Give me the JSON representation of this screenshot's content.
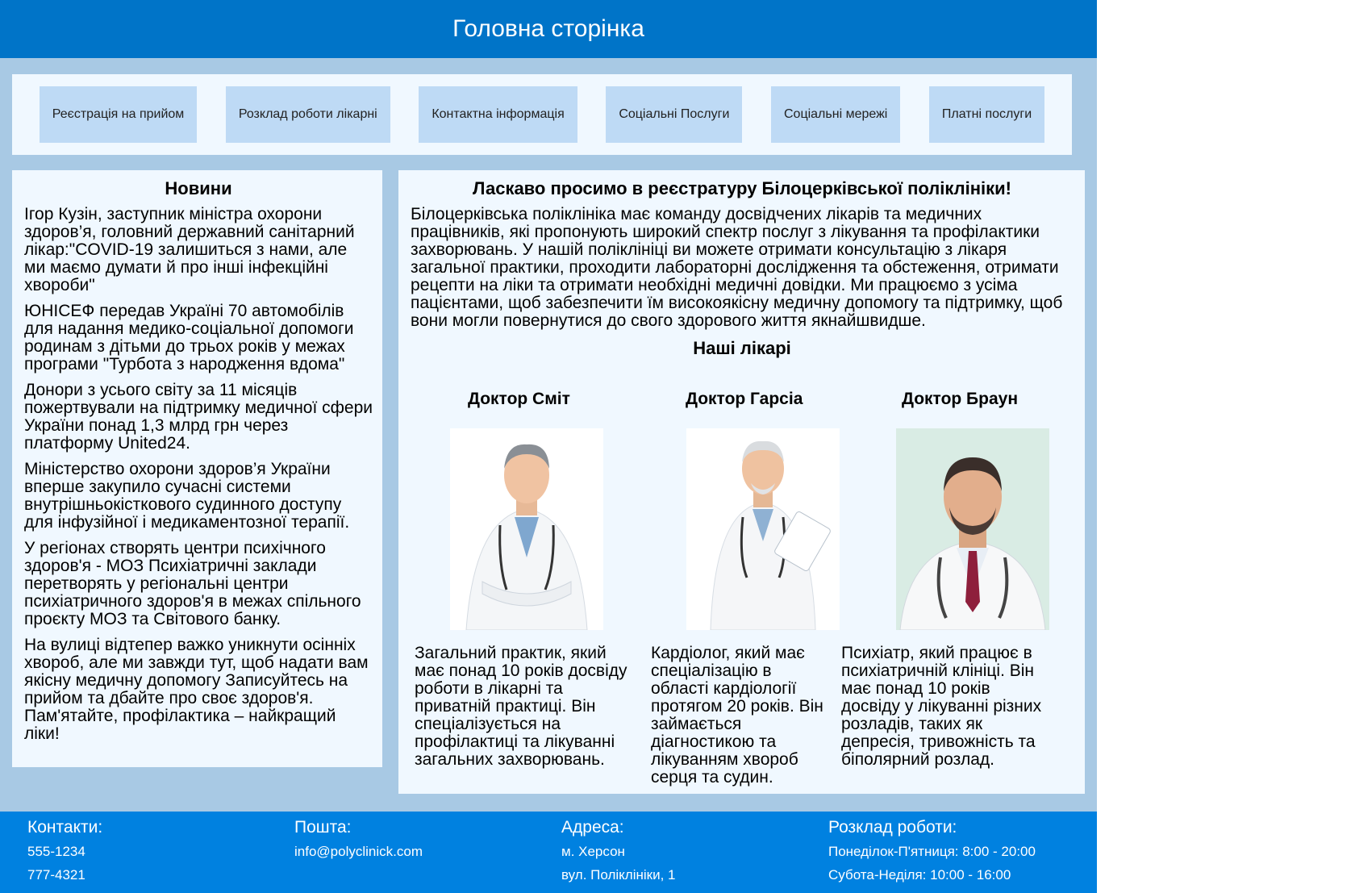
{
  "header": {
    "title": "Головна сторінка"
  },
  "nav": {
    "items": [
      "Реєстрація на прийом",
      "Розклад роботи лікарні",
      "Контактна інформація",
      "Соціальні Послуги",
      "Соціальні мережі",
      "Платні послуги"
    ]
  },
  "news": {
    "title": "Новини",
    "items": [
      "Ігор Кузін, заступник міністра охорони здоров’я, головний державний санітарний лікар:\"COVID-19 залишиться з нами, але ми маємо думати й про інші інфекційні хвороби\"",
      "ЮНІСЕФ передав Україні 70 автомобілів для надання медико-соціальної допомоги родинам з дітьми до трьох років у межах програми \"Турбота з народження вдома\"",
      "Донори з усього світу за 11 місяців пожертвували на підтримку медичної сфери України понад 1,3 млрд грн через платформу United24.",
      "Міністерство охорони здоров’я України вперше закупило сучасні системи внутрішньокісткового судинного доступу для інфузійної і медикаментозної терапії.",
      "У регіонах створять центри психічного здоров'я - МОЗ Психіатричні заклади перетворять у регіональні центри психіатричного здоров'я в межах спільного проєкту МОЗ та Світового банку.",
      "На вулиці відтепер важко уникнути осінніх хвороб, але ми завжди тут, щоб надати вам якісну медичну допомогу Записуйтесь на прийом та дбайте про своє здоров'я. Пам'ятайте, профілактика – найкращий ліки!"
    ]
  },
  "main": {
    "title": "Ласкаво просимо в реєстратуру Білоцерківської поліклініки!",
    "intro": "Білоцерківська поліклініка має команду досвідчених лікарів та медичних працівників, які пропонують широкий спектр послуг з лікування та профілактики захворювань. У нашій поліклініці ви можете отримати консультацію з лікаря загальної практики, проходити лабораторні дослідження та обстеження, отримати рецепти на ліки та отримати необхідні медичні довідки. Ми працюємо з усіма пацієнтами, щоб забезпечити їм високоякісну медичну допомогу та підтримку, щоб вони могли повернутися до свого здорового життя якнайшвидше.",
    "doctors_title": "Наші лікарі",
    "doctors": [
      {
        "name": "Доктор Сміт",
        "desc": "Загальний практик, який має понад 10 років досвіду роботи в лікарні та приватній практиці. Він спеціалізується на профілактиці та лікуванні загальних захворювань."
      },
      {
        "name": "Доктор Гарсіа",
        "desc": "Кардіолог, який має спеціалізацію в області кардіології протягом 20 років. Він займається діагностикою та лікуванням хвороб серця та судин."
      },
      {
        "name": "Доктор Браун",
        "desc": "Психіатр, який працює в психіатричній клініці. Він має понад 10 років досвіду у лікуванні різних розладів, таких як депресія, тривожність та біполярний розлад."
      }
    ]
  },
  "footer": {
    "contacts": {
      "title": "Контакти:",
      "lines": [
        "555-1234",
        "777-4321"
      ]
    },
    "mail": {
      "title": "Пошта:",
      "lines": [
        "info@polyclinick.com"
      ]
    },
    "address": {
      "title": "Адреса:",
      "lines": [
        "м. Херсон",
        "вул. Поліклініки, 1"
      ]
    },
    "schedule": {
      "title": "Розклад роботи:",
      "lines": [
        "Понеділок-П'ятниця: 8:00 - 20:00",
        "Субота-Неділя: 10:00 - 16:00"
      ]
    }
  },
  "colors": {
    "header": "#0074c8",
    "footer": "#0081e0",
    "page_bg": "#a8c9e4",
    "panel_bg": "#f0f8ff",
    "nav_item_bg": "#bedaf5"
  }
}
